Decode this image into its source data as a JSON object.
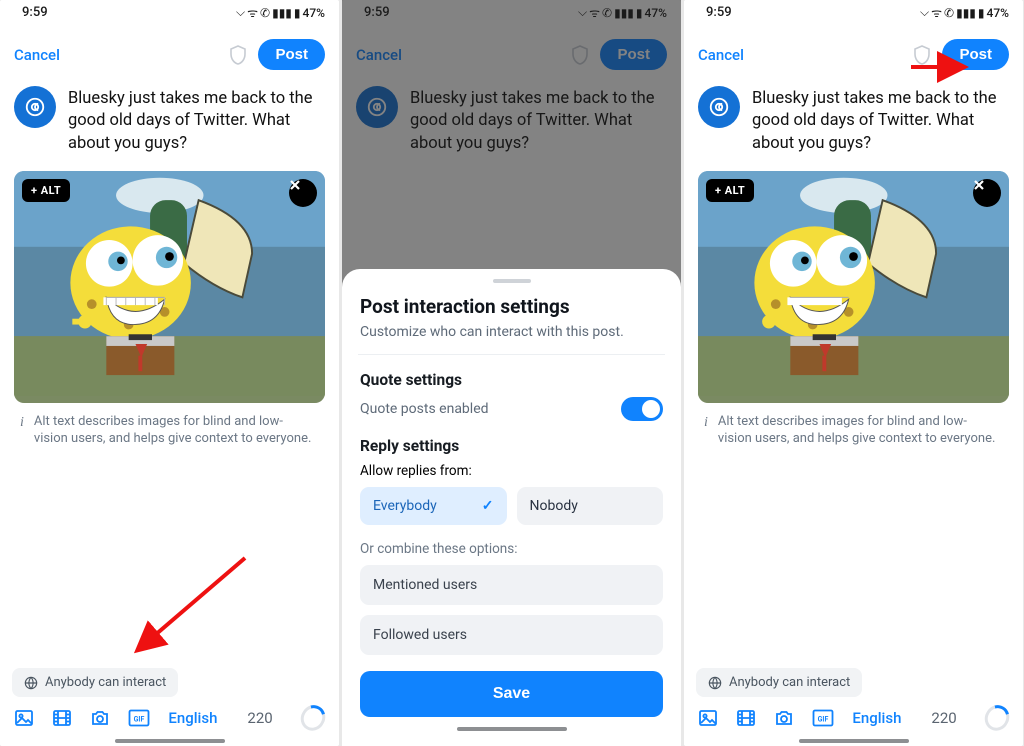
{
  "status": {
    "time": "9:59",
    "battery": "47%"
  },
  "topbar": {
    "cancel": "Cancel",
    "post": "Post"
  },
  "compose": {
    "text": "Bluesky just takes me back to the good old days of Twitter. What about you guys?"
  },
  "media": {
    "alt_badge": "+ ALT"
  },
  "alt_help": "Alt text describes images for blind and low-vision users, and helps give context to everyone.",
  "interact_chip": "Anybody can interact",
  "toolbar": {
    "language": "English",
    "count": "220"
  },
  "sheet": {
    "title": "Post interaction settings",
    "subtitle": "Customize who can interact with this post.",
    "quote_title": "Quote settings",
    "quote_label": "Quote posts enabled",
    "reply_title": "Reply settings",
    "allow_label": "Allow replies from:",
    "everybody": "Everybody",
    "nobody": "Nobody",
    "combine_label": "Or combine these options:",
    "mentioned": "Mentioned users",
    "followed": "Followed users",
    "save": "Save"
  }
}
